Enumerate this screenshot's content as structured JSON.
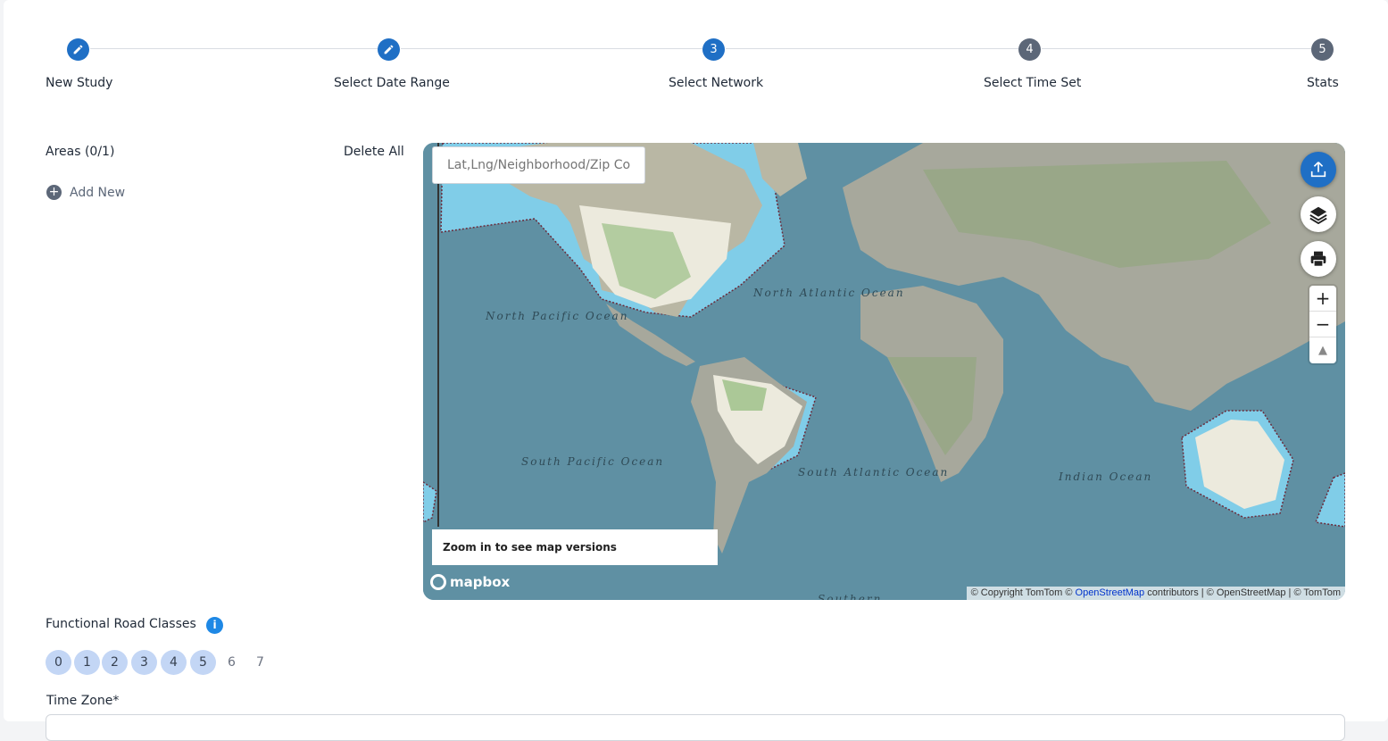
{
  "stepper": {
    "steps": [
      {
        "label": "New Study",
        "marker": "",
        "state": "done"
      },
      {
        "label": "Select Date Range",
        "marker": "",
        "state": "done"
      },
      {
        "label": "Select Network",
        "marker": "3",
        "state": "active"
      },
      {
        "label": "Select Time Set",
        "marker": "4",
        "state": "pending"
      },
      {
        "label": "Stats",
        "marker": "5",
        "state": "pending"
      }
    ]
  },
  "areas": {
    "title": "Areas (0/1)",
    "delete_all": "Delete All",
    "add_new": "Add New"
  },
  "map": {
    "search_placeholder": "Lat,Lng/Neighborhood/Zip Cod",
    "versions_notice": "Zoom in to see map versions",
    "logo_text": "mapbox",
    "attribution_prefix": "© Copyright TomTom ©",
    "attribution_link": "OpenStreetMap",
    "attribution_suffix": "contributors | © OpenStreetMap | © TomTom",
    "oceans": {
      "north_pacific": "North Pacific Ocean",
      "north_atlantic": "North Atlantic Ocean",
      "south_pacific": "South Pacific Ocean",
      "south_atlantic": "South Atlantic Ocean",
      "indian": "Indian Ocean",
      "southern": "Southern"
    },
    "zoom_in": "+",
    "zoom_out": "−",
    "compass": "▲"
  },
  "road_classes": {
    "title": "Functional Road Classes",
    "info": "i",
    "classes": [
      {
        "label": "0",
        "selected": true
      },
      {
        "label": "1",
        "selected": true
      },
      {
        "label": "2",
        "selected": true
      },
      {
        "label": "3",
        "selected": true
      },
      {
        "label": "4",
        "selected": true
      },
      {
        "label": "5",
        "selected": true
      },
      {
        "label": "6",
        "selected": false
      },
      {
        "label": "7",
        "selected": false
      }
    ]
  },
  "time_zone": {
    "label": "Time Zone*"
  },
  "colors": {
    "primary": "#1f6fc5",
    "pending": "#5c6778",
    "chip_selected": "#c3d6f5",
    "ocean": "#5f90a3",
    "land": "#a7a89c",
    "highlight_region": "#80cde8"
  }
}
